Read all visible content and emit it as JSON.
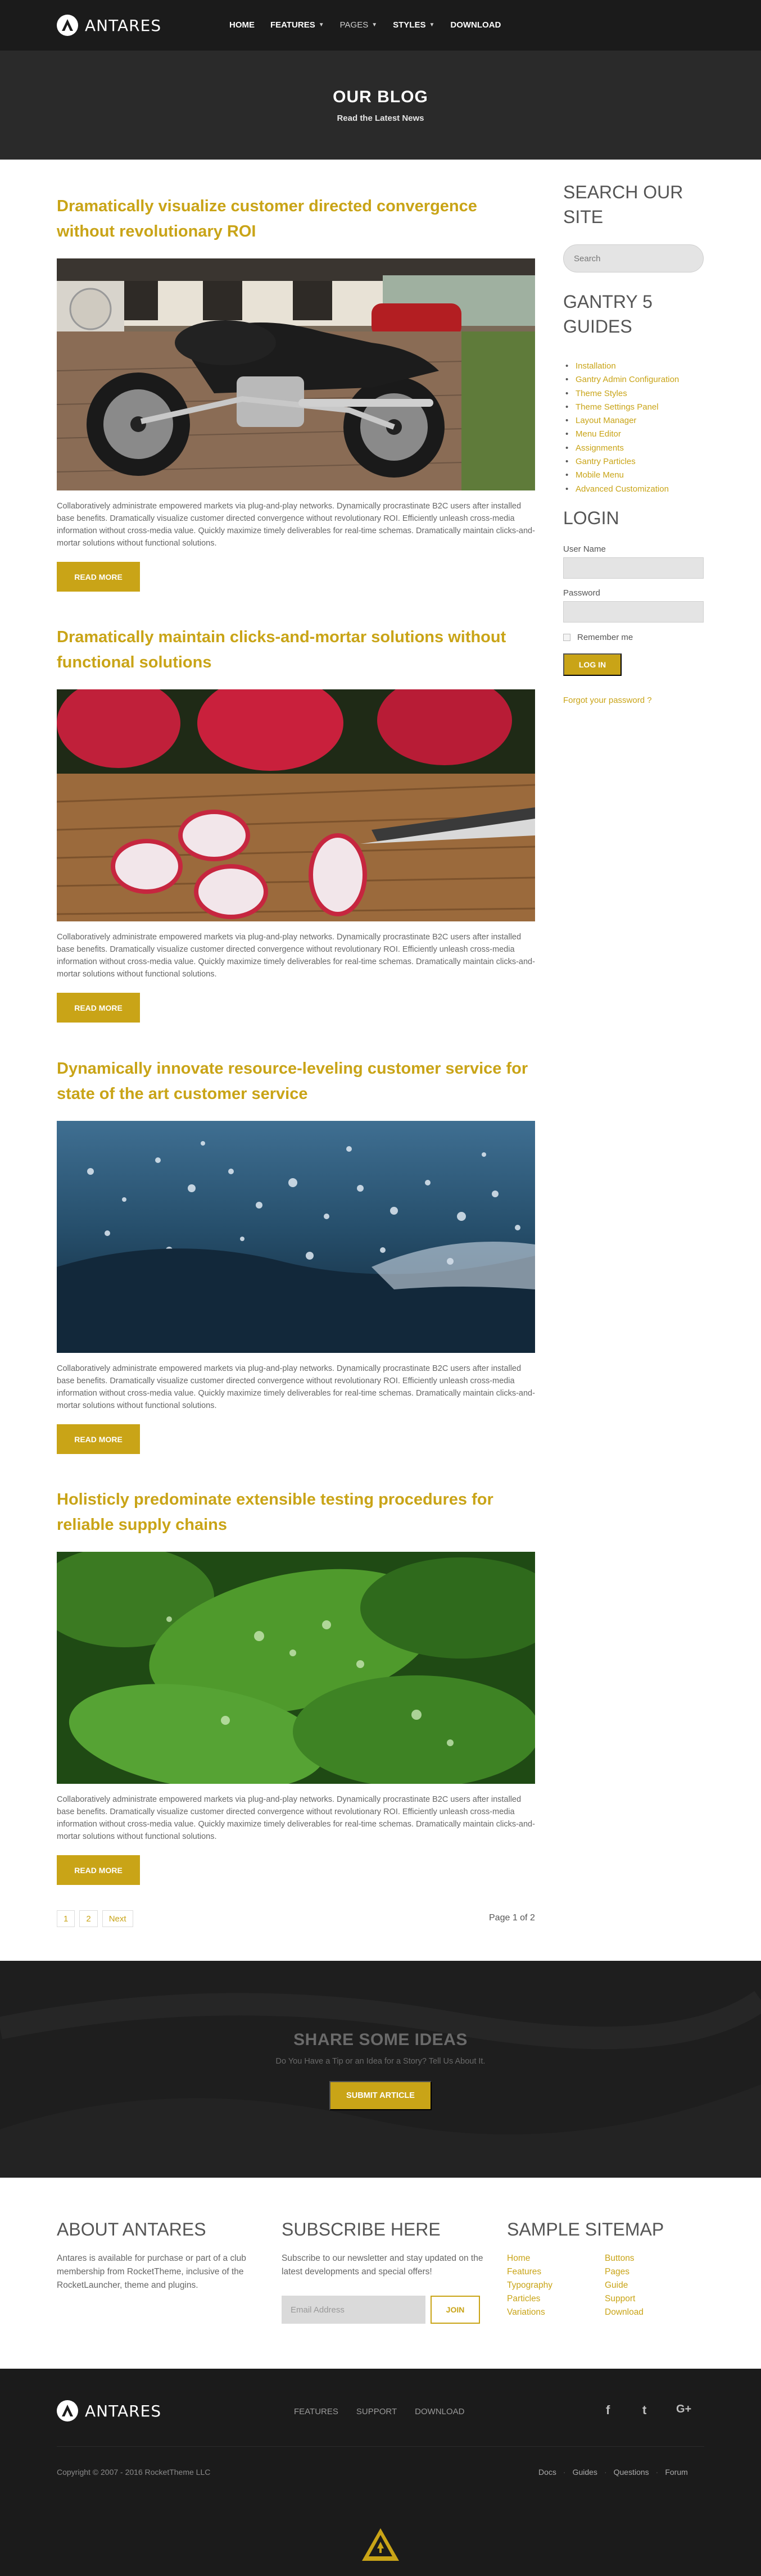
{
  "brand": {
    "name": "ANTARES",
    "accent": "#c9a417",
    "dark": "#1b1b1b"
  },
  "nav": {
    "items": [
      {
        "label": "HOME",
        "dropdown": false
      },
      {
        "label": "FEATURES",
        "dropdown": true
      },
      {
        "label": "PAGES",
        "dropdown": true
      },
      {
        "label": "STYLES",
        "dropdown": true
      },
      {
        "label": "DOWNLOAD",
        "dropdown": false
      }
    ]
  },
  "hero": {
    "title": "OUR BLOG",
    "subtitle": "Read the Latest News"
  },
  "posts": [
    {
      "title": "Dramatically visualize customer directed convergence without revolutionary ROI",
      "image": "motorcycle-photo",
      "body": "Collaboratively administrate empowered markets via plug-and-play networks. Dynamically procrastinate B2C users after installed base benefits. Dramatically visualize customer directed convergence without revolutionary ROI. Efficiently unleash cross-media information without cross-media value. Quickly maximize timely deliverables for real-time schemas. Dramatically maintain clicks-and-mortar solutions without functional solutions.",
      "button": "READ MORE"
    },
    {
      "title": "Dramatically maintain clicks-and-mortar solutions without functional solutions",
      "image": "radish-photo",
      "body": "Collaboratively administrate empowered markets via plug-and-play networks. Dynamically procrastinate B2C users after installed base benefits. Dramatically visualize customer directed convergence without revolutionary ROI. Efficiently unleash cross-media information without cross-media value. Quickly maximize timely deliverables for real-time schemas. Dramatically maintain clicks-and-mortar solutions without functional solutions.",
      "button": "READ MORE"
    },
    {
      "title": "Dynamically innovate resource-leveling customer service for state of the art customer service",
      "image": "water-splash-photo",
      "body": "Collaboratively administrate empowered markets via plug-and-play networks. Dynamically procrastinate B2C users after installed base benefits. Dramatically visualize customer directed convergence without revolutionary ROI. Efficiently unleash cross-media information without cross-media value. Quickly maximize timely deliverables for real-time schemas. Dramatically maintain clicks-and-mortar solutions without functional solutions.",
      "button": "READ MORE"
    },
    {
      "title": "Holisticly predominate extensible testing procedures for reliable supply chains",
      "image": "green-leaves-photo",
      "body": "Collaboratively administrate empowered markets via plug-and-play networks. Dynamically procrastinate B2C users after installed base benefits. Dramatically visualize customer directed convergence without revolutionary ROI. Efficiently unleash cross-media information without cross-media value. Quickly maximize timely deliverables for real-time schemas. Dramatically maintain clicks-and-mortar solutions without functional solutions.",
      "button": "READ MORE"
    }
  ],
  "sidebar": {
    "search_title": "SEARCH OUR SITE",
    "search_placeholder": "Search",
    "guides_title": "GANTRY 5 GUIDES",
    "guides": [
      "Installation",
      "Gantry Admin Configuration",
      "Theme Styles",
      "Theme Settings Panel",
      "Layout Manager",
      "Menu Editor",
      "Assignments",
      "Gantry Particles",
      "Mobile Menu",
      "Advanced Customization"
    ],
    "login_title": "LOGIN",
    "username_label": "User Name",
    "password_label": "Password",
    "remember_label": "Remember me",
    "login_button": "LOG IN",
    "forgot_link": "Forgot your password ?"
  },
  "pagination": {
    "pages": [
      "1",
      "2",
      "Next"
    ],
    "status": "Page 1 of 2"
  },
  "share": {
    "title": "SHARE SOME IDEAS",
    "text": "Do You Have a Tip or an Idea for a Story? Tell Us About It.",
    "button": "SUBMIT ARTICLE"
  },
  "about": {
    "title": "ABOUT ANTARES",
    "text": "Antares is available for purchase or part of a club membership from RocketTheme, inclusive of the RocketLauncher, theme and plugins."
  },
  "subscribe": {
    "title": "SUBSCRIBE HERE",
    "text": "Subscribe to our newsletter and stay updated on the latest developments and special offers!",
    "placeholder": "Email Address",
    "button": "JOIN"
  },
  "sitemap": {
    "title": "SAMPLE SITEMAP",
    "col1": [
      "Home",
      "Features",
      "Typography",
      "Particles",
      "Variations"
    ],
    "col2": [
      "Buttons",
      "Pages",
      "Guide",
      "Support",
      "Download"
    ]
  },
  "footer": {
    "brand": "ANTARES",
    "nav": [
      "FEATURES",
      "SUPPORT",
      "DOWNLOAD"
    ],
    "social": [
      "f",
      "t",
      "G+"
    ],
    "copyright": "Copyright © 2007 - 2016 RocketTheme LLC",
    "links": [
      "Docs",
      "Guides",
      "Questions",
      "Forum"
    ]
  }
}
